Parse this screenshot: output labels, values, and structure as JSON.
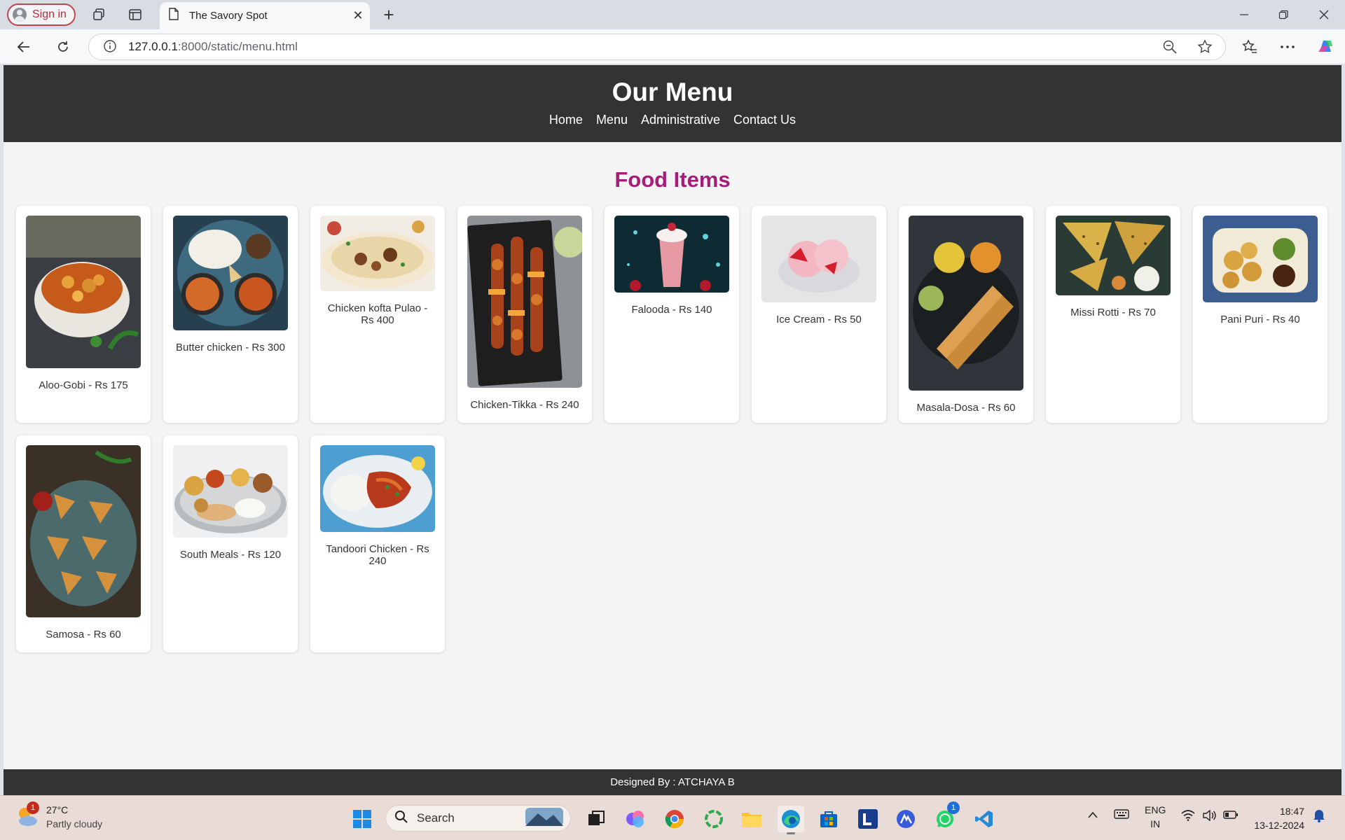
{
  "browser": {
    "signin_label": "Sign in",
    "tab_title": "The Savory Spot",
    "url_host": "127.0.0.1",
    "url_path": ":8000/static/menu.html"
  },
  "header": {
    "title": "Our Menu",
    "nav": [
      "Home",
      "Menu",
      "Administrative",
      "Contact Us"
    ]
  },
  "section_title": "Food Items",
  "items": [
    {
      "caption": "Aloo-Gobi - Rs 175"
    },
    {
      "caption": "Butter chicken - Rs 300"
    },
    {
      "caption": "Chicken kofta Pulao - Rs 400"
    },
    {
      "caption": "Chicken-Tikka - Rs 240"
    },
    {
      "caption": "Falooda - Rs 140"
    },
    {
      "caption": "Ice Cream - Rs 50"
    },
    {
      "caption": "Masala-Dosa - Rs 60"
    },
    {
      "caption": "Missi Rotti - Rs 70"
    },
    {
      "caption": "Pani Puri - Rs 40"
    },
    {
      "caption": "Samosa - Rs 60"
    },
    {
      "caption": "South Meals - Rs 120"
    },
    {
      "caption": "Tandoori Chicken - Rs 240"
    }
  ],
  "footer": "Designed By : ATCHAYA B",
  "taskbar": {
    "weather_badge": "1",
    "weather_temp": "27°C",
    "weather_desc": "Partly cloudy",
    "search_label": "Search",
    "whatsapp_badge": "1",
    "lang_top": "ENG",
    "lang_bottom": "IN",
    "time": "18:47",
    "date": "13-12-2024"
  }
}
